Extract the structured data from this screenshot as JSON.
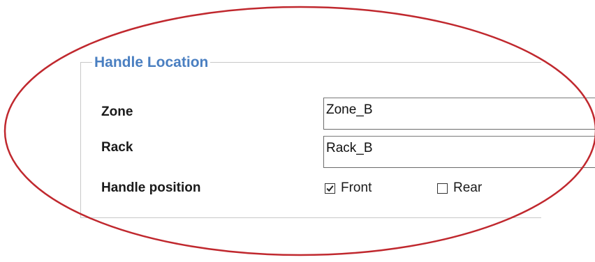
{
  "group": {
    "title": "Handle Location"
  },
  "fields": {
    "zone": {
      "label": "Zone",
      "value": "Zone_B"
    },
    "rack": {
      "label": "Rack",
      "value": "Rack_B"
    }
  },
  "handle_position": {
    "label": "Handle position",
    "options": [
      {
        "label": "Front",
        "checked": true
      },
      {
        "label": "Rear",
        "checked": false
      }
    ]
  },
  "colors": {
    "legend_text": "#4a7fc1",
    "highlight_ellipse": "#c0282e",
    "group_border": "#c8c8c8"
  }
}
